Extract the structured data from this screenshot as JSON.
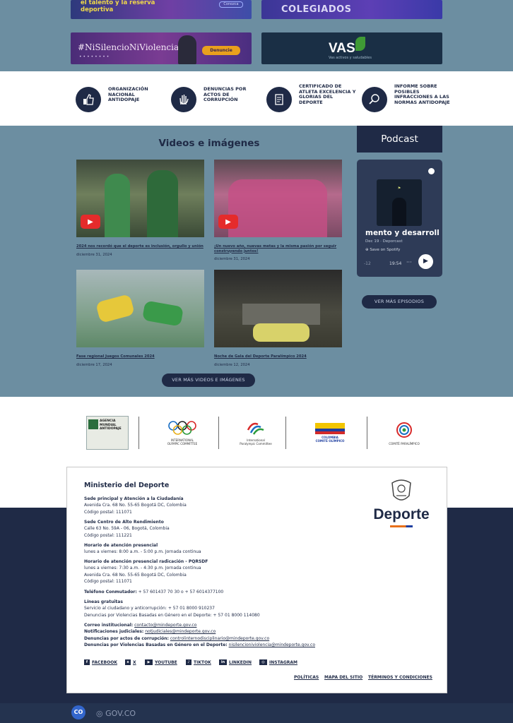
{
  "banners": {
    "top_left_line1": "el talento y la reserva",
    "top_left_line2": "deportiva",
    "top_left_button": "Conozca",
    "top_right_text": "COLEGIADOS",
    "silencio_text": "#NiSilencioNiViolencia",
    "silencio_button": "Denuncie",
    "vas_text": "VAS",
    "vas_sub": "Vas activos y saludables"
  },
  "quick_links": [
    {
      "label": "ORGANIZACIÓN NACIONAL ANTIDOPAJE",
      "icon": "hand-thumb-icon"
    },
    {
      "label": "DENUNCIAS POR ACTOS DE CORRUPCIÓN",
      "icon": "hand-stop-icon"
    },
    {
      "label": "CERTIFICADO DE ATLETA EXCELENCIA Y GLORIAS DEL DEPORTE",
      "icon": "document-icon"
    },
    {
      "label": "INFORME SOBRE POSIBLES INFRACCIONES A LAS NORMAS ANTIDOPAJE",
      "icon": "magnifier-icon"
    }
  ],
  "videos": {
    "heading": "Videos e imágenes",
    "items": [
      {
        "caption": "2024 nos recordó que el deporte es inclusión, orgullo y unión",
        "date": "diciembre 31, 2024"
      },
      {
        "caption": "¡Un nuevo año, nuevas metas y la misma pasión por seguir construyendo juntos!",
        "date": "diciembre 31, 2024"
      },
      {
        "caption": "Fase regional Juegos Comunales 2024",
        "date": "diciembre 17, 2024"
      },
      {
        "caption": "Noche de Gala del Deporte Paralímpico 2024",
        "date": "diciembre 12, 2024"
      }
    ],
    "more_button": "VER MÁS VIDEOS E IMÁGENES"
  },
  "podcast": {
    "heading": "Podcast",
    "episode_title": "mento y desarrollo",
    "meta": "Dec 19 · Deporcast",
    "save": "Save on Spotify",
    "progress": "-12",
    "time": "19:54",
    "more_button": "VER MÁS EPISODIOS"
  },
  "partners": [
    {
      "name": "AGENCIA MUNDIAL ANTIDOPAJE"
    },
    {
      "name": "INTERNATIONAL OLYMPIC COMMITTEE"
    },
    {
      "name": "International Paralympic Committee"
    },
    {
      "name": "COLOMBIA COMITÉ OLÍMPICO"
    },
    {
      "name": "COMITÉ PARALÍMPICO"
    }
  ],
  "footer": {
    "title": "Ministerio del Deporte",
    "brand": "Deporte",
    "lines": [
      {
        "bold": "Sede principal y Atención a la Ciudadanía",
        "text": ""
      },
      {
        "bold": "",
        "text": "Avenida Cra. 68 No. 55-65 Bogotá DC, Colombia"
      },
      {
        "bold": "",
        "text": "Código postal: 111071"
      },
      {
        "bold": "Sede Centro de Alto Rendimiento",
        "text": ""
      },
      {
        "bold": "",
        "text": "Calle 63 No. 59A - 06, Bogotá, Colombia"
      },
      {
        "bold": "",
        "text": "Código postal: 111221"
      },
      {
        "bold": "Horario de atención presencial",
        "text": ""
      },
      {
        "bold": "",
        "text": "lunes a viernes: 8:00 a.m. - 5:00 p.m. Jornada continua"
      },
      {
        "bold": "Horario de atención presencial radicación - PQRSDF",
        "text": ""
      },
      {
        "bold": "",
        "text": "lunes a viernes: 7:30 a.m. - 4:30 p.m. Jornada continua"
      },
      {
        "bold": "",
        "text": "Avenida Cra. 68 No. 55-65 Bogotá DC, Colombia"
      },
      {
        "bold": "",
        "text": "Código postal: 111071"
      },
      {
        "bold": "Teléfono Conmutador:",
        "text": " + 57 601437 70 30 o + 57 6014377100"
      },
      {
        "bold": "Líneas gratuitas",
        "text": ""
      },
      {
        "bold": "",
        "text": "Servicio al ciudadano y anticorrupción: + 57 01 8000 910237"
      },
      {
        "bold": "",
        "text": "Denuncias por Violencias Basadas en Género en el Deporte: + 57 01 8000 114080"
      },
      {
        "bold": "Correo institucional:",
        "text": "contacto@mindeporte.gov.co"
      },
      {
        "bold": "Notificaciones judiciales:",
        "text": "notjudiciales@mindeporte.gov.co"
      },
      {
        "bold": "Denuncias por actos de corrupción:",
        "text": "controlinternodisciplinario@mindeporte.gov.co"
      },
      {
        "bold": "Denuncias por Violencias Basadas en Género en el Deporte:",
        "text": "nisilencioniviolencia@mindeporte.gov.co"
      }
    ],
    "social": [
      "FACEBOOK",
      "X",
      "YOUTUBE",
      "TIKTOK",
      "LINKEDIN",
      "INSTAGRAM"
    ],
    "links": [
      "POLÍTICAS",
      "MAPA DEL SITIO",
      "TÉRMINOS Y CONDICIONES"
    ]
  },
  "govbar": {
    "logo": "CO",
    "text": "GOV.CO"
  }
}
